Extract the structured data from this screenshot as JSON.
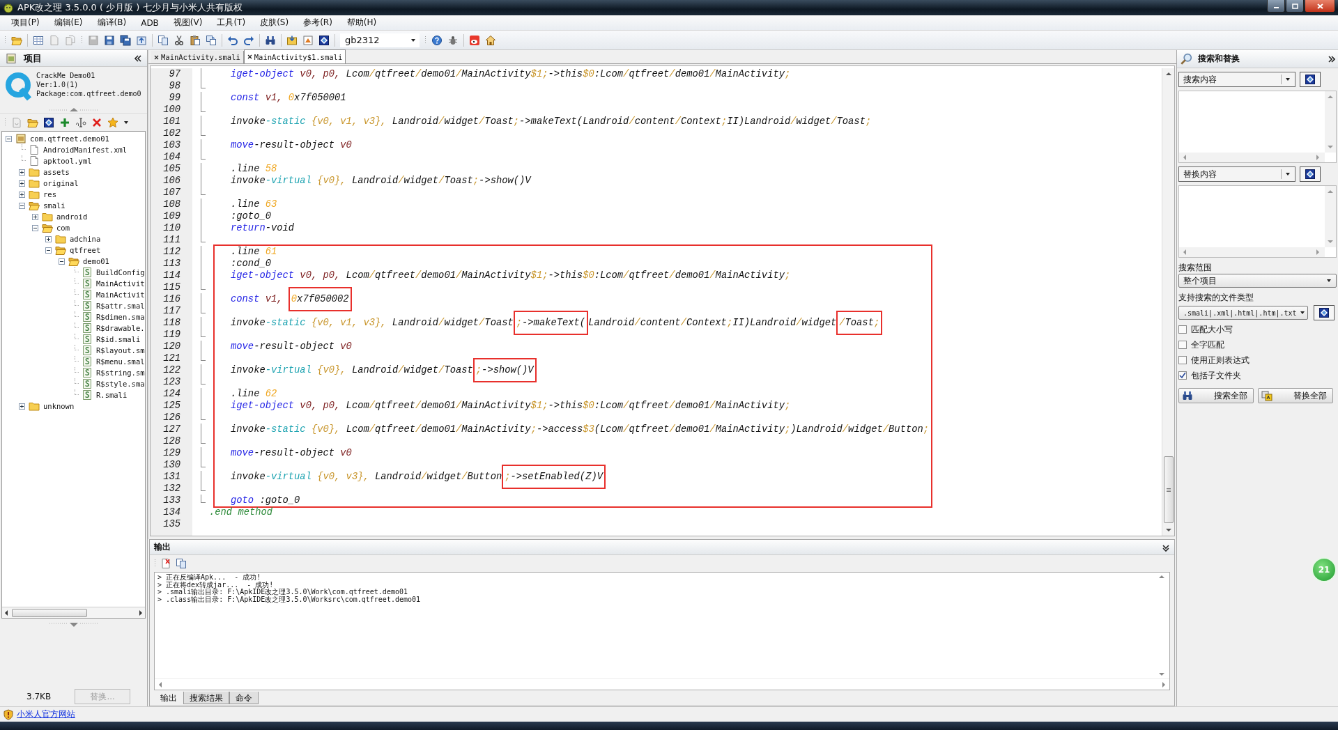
{
  "window": {
    "title": "APK改之理 3.5.0.0 ( 少月版 ) 七少月与小米人共有版权"
  },
  "menu": [
    "项目(P)",
    "编辑(E)",
    "编译(B)",
    "ADB",
    "视图(V)",
    "工具(T)",
    "皮肤(S)",
    "参考(R)",
    "帮助(H)"
  ],
  "toolbar": {
    "encoding": "gb2312"
  },
  "project": {
    "title": "项目",
    "app_name": "CrackMe Demo01",
    "version": "Ver:1.0(1)",
    "package": "Package:com.qtfreet.demo0",
    "tree": [
      {
        "label": "com.qtfreet.demo01",
        "kind": "project",
        "expanded": true,
        "children": [
          {
            "label": "AndroidManifest.xml",
            "kind": "file"
          },
          {
            "label": "apktool.yml",
            "kind": "file"
          },
          {
            "label": "assets",
            "kind": "folder",
            "expanded": false
          },
          {
            "label": "original",
            "kind": "folder",
            "expanded": false
          },
          {
            "label": "res",
            "kind": "folder",
            "expanded": false
          },
          {
            "label": "smali",
            "kind": "folder",
            "expanded": true,
            "children": [
              {
                "label": "android",
                "kind": "folder",
                "expanded": false
              },
              {
                "label": "com",
                "kind": "folder",
                "expanded": true,
                "children": [
                  {
                    "label": "adchina",
                    "kind": "folder",
                    "expanded": false
                  },
                  {
                    "label": "qtfreet",
                    "kind": "folder",
                    "expanded": true,
                    "children": [
                      {
                        "label": "demo01",
                        "kind": "folder",
                        "expanded": true,
                        "children": [
                          {
                            "label": "BuildConfig",
                            "kind": "smali"
                          },
                          {
                            "label": "MainActivit",
                            "kind": "smali"
                          },
                          {
                            "label": "MainActivit",
                            "kind": "smali"
                          },
                          {
                            "label": "R$attr.smal",
                            "kind": "smali"
                          },
                          {
                            "label": "R$dimen.sma",
                            "kind": "smali"
                          },
                          {
                            "label": "R$drawable.",
                            "kind": "smali"
                          },
                          {
                            "label": "R$id.smali",
                            "kind": "smali"
                          },
                          {
                            "label": "R$layout.sm",
                            "kind": "smali"
                          },
                          {
                            "label": "R$menu.smal",
                            "kind": "smali"
                          },
                          {
                            "label": "R$string.sm",
                            "kind": "smali"
                          },
                          {
                            "label": "R$style.sma",
                            "kind": "smali"
                          },
                          {
                            "label": "R.smali",
                            "kind": "smali"
                          }
                        ]
                      }
                    ]
                  }
                ]
              }
            ]
          },
          {
            "label": "unknown",
            "kind": "folder",
            "expanded": false
          }
        ]
      }
    ],
    "size": "3.7KB",
    "replace_button": {
      "label": "替换...",
      "disabled": true
    }
  },
  "editor": {
    "tabs": [
      {
        "label": "MainActivity.smali",
        "selected": false
      },
      {
        "label": "MainActivity$1.smali",
        "selected": true
      }
    ],
    "lines": [
      {
        "number": "97",
        "kind": "body",
        "indented": true,
        "boxed": false,
        "tokens": [
          {
            "kind": "kw",
            "text": "iget-object",
            "marked": false
          },
          {
            "kind": "reg",
            "text": " v0, p0,",
            "marked": false
          },
          {
            "kind": "txt",
            "text": " Lcom/qtfreet/demo01/MainActivity",
            "marked": false
          },
          {
            "kind": "sym",
            "text": "$1",
            "marked": false
          },
          {
            "kind": "txt",
            "text": ";->this",
            "marked": false
          },
          {
            "kind": "sym",
            "text": "$0",
            "marked": false
          },
          {
            "kind": "txt",
            "text": ":Lcom/qtfreet/demo01/MainActivity;",
            "marked": false
          }
        ]
      },
      {
        "number": "98",
        "kind": "end"
      },
      {
        "number": "99",
        "kind": "body",
        "indented": true,
        "boxed": false,
        "tokens": [
          {
            "kind": "kw",
            "text": "const",
            "marked": false
          },
          {
            "kind": "reg",
            "text": " v1, ",
            "marked": false
          },
          {
            "kind": "num",
            "text": "0",
            "marked": false
          },
          {
            "kind": "txt",
            "text": "x7f050001",
            "marked": false
          }
        ]
      },
      {
        "number": "100",
        "kind": "end"
      },
      {
        "number": "101",
        "kind": "body",
        "indented": true,
        "boxed": false,
        "tokens": [
          {
            "kind": "txt",
            "text": "invoke",
            "marked": false
          },
          {
            "kind": "kw2",
            "text": "-static",
            "marked": false
          },
          {
            "kind": "sym",
            "text": " {v0, v1, v3},",
            "marked": false
          },
          {
            "kind": "txt",
            "text": " Landroid/widget/Toast;->makeText(Landroid/content/Context;II)Landroid/widget/Toast;",
            "marked": false
          }
        ]
      },
      {
        "number": "102",
        "kind": "end"
      },
      {
        "number": "103",
        "kind": "body",
        "indented": true,
        "boxed": false,
        "tokens": [
          {
            "kind": "kw",
            "text": "move",
            "marked": false
          },
          {
            "kind": "txt",
            "text": "-result-object",
            "marked": false
          },
          {
            "kind": "reg",
            "text": " v0",
            "marked": false
          }
        ]
      },
      {
        "number": "104",
        "kind": "end"
      },
      {
        "number": "105",
        "kind": "body",
        "indented": true,
        "boxed": false,
        "tokens": [
          {
            "kind": "txt",
            "text": ".line ",
            "marked": false
          },
          {
            "kind": "num",
            "text": "58",
            "marked": false
          }
        ]
      },
      {
        "number": "106",
        "kind": "body",
        "indented": true,
        "boxed": false,
        "tokens": [
          {
            "kind": "txt",
            "text": "invoke",
            "marked": false
          },
          {
            "kind": "kw2",
            "text": "-virtual",
            "marked": false
          },
          {
            "kind": "sym",
            "text": " {v0},",
            "marked": false
          },
          {
            "kind": "txt",
            "text": " Landroid/widget/Toast;->show()V",
            "marked": false
          }
        ]
      },
      {
        "number": "107",
        "kind": "end"
      },
      {
        "number": "108",
        "kind": "body",
        "indented": true,
        "boxed": false,
        "tokens": [
          {
            "kind": "txt",
            "text": ".line ",
            "marked": false
          },
          {
            "kind": "num",
            "text": "63",
            "marked": false
          }
        ]
      },
      {
        "number": "109",
        "kind": "body",
        "indented": true,
        "boxed": false,
        "tokens": [
          {
            "kind": "txt",
            "text": ":goto_0",
            "marked": false
          }
        ]
      },
      {
        "number": "110",
        "kind": "body",
        "indented": true,
        "boxed": false,
        "tokens": [
          {
            "kind": "kw",
            "text": "return",
            "marked": false
          },
          {
            "kind": "txt",
            "text": "-void",
            "marked": false
          }
        ]
      },
      {
        "number": "111",
        "kind": "end"
      },
      {
        "number": "112",
        "kind": "body",
        "indented": true,
        "boxed": true,
        "tokens": [
          {
            "kind": "txt",
            "text": ".line ",
            "marked": false
          },
          {
            "kind": "num",
            "text": "61",
            "marked": false
          }
        ]
      },
      {
        "number": "113",
        "kind": "body",
        "indented": true,
        "boxed": true,
        "tokens": [
          {
            "kind": "txt",
            "text": ":cond_0",
            "marked": false
          }
        ]
      },
      {
        "number": "114",
        "kind": "body",
        "indented": true,
        "boxed": true,
        "tokens": [
          {
            "kind": "kw",
            "text": "iget-object",
            "marked": false
          },
          {
            "kind": "reg",
            "text": " v0, p0,",
            "marked": false
          },
          {
            "kind": "txt",
            "text": " Lcom/qtfreet/demo01/MainActivity",
            "marked": false
          },
          {
            "kind": "sym",
            "text": "$1",
            "marked": false
          },
          {
            "kind": "txt",
            "text": ";->this",
            "marked": false
          },
          {
            "kind": "sym",
            "text": "$0",
            "marked": false
          },
          {
            "kind": "txt",
            "text": ":Lcom/qtfreet/demo01/MainActivity;",
            "marked": false
          }
        ]
      },
      {
        "number": "115",
        "kind": "end"
      },
      {
        "number": "116",
        "kind": "body",
        "indented": true,
        "boxed": true,
        "tokens": [
          {
            "kind": "kw",
            "text": "const",
            "marked": false
          },
          {
            "kind": "reg",
            "text": " v1, ",
            "marked": false
          },
          {
            "kind": "num",
            "text": "0",
            "marked": true
          },
          {
            "kind": "txt",
            "text": "x7f050002",
            "marked": true
          }
        ]
      },
      {
        "number": "117",
        "kind": "end"
      },
      {
        "number": "118",
        "kind": "body",
        "indented": true,
        "boxed": true,
        "tokens": [
          {
            "kind": "txt",
            "text": "invoke",
            "marked": false
          },
          {
            "kind": "kw2",
            "text": "-static",
            "marked": false
          },
          {
            "kind": "sym",
            "text": " {v0, v1, v3},",
            "marked": false
          },
          {
            "kind": "txt",
            "text": " Landroid/widget/Toast",
            "marked": false
          },
          {
            "kind": "txt",
            "text": ";->makeText(",
            "marked": true
          },
          {
            "kind": "txt",
            "text": "Landroid/content/Context;II)Landroid/widget",
            "marked": false
          },
          {
            "kind": "txt",
            "text": "/Toast;",
            "marked": true
          }
        ]
      },
      {
        "number": "119",
        "kind": "end"
      },
      {
        "number": "120",
        "kind": "body",
        "indented": true,
        "boxed": true,
        "tokens": [
          {
            "kind": "kw",
            "text": "move",
            "marked": false
          },
          {
            "kind": "txt",
            "text": "-result-object",
            "marked": false
          },
          {
            "kind": "reg",
            "text": " v0",
            "marked": false
          }
        ]
      },
      {
        "number": "121",
        "kind": "end"
      },
      {
        "number": "122",
        "kind": "body",
        "indented": true,
        "boxed": true,
        "tokens": [
          {
            "kind": "txt",
            "text": "invoke",
            "marked": false
          },
          {
            "kind": "kw2",
            "text": "-virtual",
            "marked": false
          },
          {
            "kind": "sym",
            "text": " {v0},",
            "marked": false
          },
          {
            "kind": "txt",
            "text": " Landroid/widget/Toast",
            "marked": false
          },
          {
            "kind": "txt",
            "text": ";->show()V",
            "marked": true
          }
        ]
      },
      {
        "number": "123",
        "kind": "end"
      },
      {
        "number": "124",
        "kind": "body",
        "indented": true,
        "boxed": true,
        "tokens": [
          {
            "kind": "txt",
            "text": ".line ",
            "marked": false
          },
          {
            "kind": "num",
            "text": "62",
            "marked": false
          }
        ]
      },
      {
        "number": "125",
        "kind": "body",
        "indented": true,
        "boxed": true,
        "tokens": [
          {
            "kind": "kw",
            "text": "iget-object",
            "marked": false
          },
          {
            "kind": "reg",
            "text": " v0, p0,",
            "marked": false
          },
          {
            "kind": "txt",
            "text": " Lcom/qtfreet/demo01/MainActivity",
            "marked": false
          },
          {
            "kind": "sym",
            "text": "$1",
            "marked": false
          },
          {
            "kind": "txt",
            "text": ";->this",
            "marked": false
          },
          {
            "kind": "sym",
            "text": "$0",
            "marked": false
          },
          {
            "kind": "txt",
            "text": ":Lcom/qtfreet/demo01/MainActivity;",
            "marked": false
          }
        ]
      },
      {
        "number": "126",
        "kind": "end"
      },
      {
        "number": "127",
        "kind": "body",
        "indented": true,
        "boxed": true,
        "tokens": [
          {
            "kind": "txt",
            "text": "invoke",
            "marked": false
          },
          {
            "kind": "kw2",
            "text": "-static",
            "marked": false
          },
          {
            "kind": "sym",
            "text": " {v0},",
            "marked": false
          },
          {
            "kind": "txt",
            "text": " Lcom/qtfreet/demo01/MainActivity;->access",
            "marked": false
          },
          {
            "kind": "sym",
            "text": "$3",
            "marked": false
          },
          {
            "kind": "txt",
            "text": "(Lcom/qtfreet/demo01/MainActivity;)Landroid/widget/Button;",
            "marked": false
          }
        ]
      },
      {
        "number": "128",
        "kind": "end"
      },
      {
        "number": "129",
        "kind": "body",
        "indented": true,
        "boxed": true,
        "tokens": [
          {
            "kind": "kw",
            "text": "move",
            "marked": false
          },
          {
            "kind": "txt",
            "text": "-result-object",
            "marked": false
          },
          {
            "kind": "reg",
            "text": " v0",
            "marked": false
          }
        ]
      },
      {
        "number": "130",
        "kind": "end"
      },
      {
        "number": "131",
        "kind": "body",
        "indented": true,
        "boxed": true,
        "tokens": [
          {
            "kind": "txt",
            "text": "invoke",
            "marked": false
          },
          {
            "kind": "kw2",
            "text": "-virtual",
            "marked": false
          },
          {
            "kind": "sym",
            "text": " {v0, v3},",
            "marked": false
          },
          {
            "kind": "txt",
            "text": " Landroid/widget/Button",
            "marked": false
          },
          {
            "kind": "txt",
            "text": ";->setEnabled(Z)V",
            "marked": true
          }
        ]
      },
      {
        "number": "132",
        "kind": "end"
      },
      {
        "number": "133",
        "kind": "end",
        "indented": true,
        "boxed": true,
        "tokens": [
          {
            "kind": "kw",
            "text": "goto",
            "marked": false
          },
          {
            "kind": "txt",
            "text": " :goto_0",
            "marked": false
          }
        ]
      },
      {
        "number": "134",
        "kind": "outside",
        "indented": false,
        "boxed": false,
        "tokens": [
          {
            "kind": "end",
            "text": ".end method",
            "marked": false
          }
        ]
      },
      {
        "number": "135",
        "kind": "outside"
      }
    ]
  },
  "output": {
    "title": "输出",
    "lines": [
      "> 正在反编译Apk...  - 成功!",
      "> 正在将dex转成jar...  - 成功!",
      "> .smali输出目录: F:\\ApkIDE改之理3.5.0\\Work\\com.qtfreet.demo01",
      "> .class输出目录: F:\\ApkIDE改之理3.5.0\\Worksrc\\com.qtfreet.demo01"
    ],
    "tabs": [
      {
        "label": "输出",
        "selected": true
      },
      {
        "label": "搜索结果",
        "selected": false
      },
      {
        "label": "命令",
        "selected": false
      }
    ]
  },
  "search": {
    "title": "搜索和替换",
    "search_field": {
      "value": "搜索内容"
    },
    "replace_field": {
      "value": "替换内容"
    },
    "scope_label": "搜索范围",
    "scope": "整个项目",
    "types_label": "支持搜索的文件类型",
    "types": ".smali|.xml|.html|.htm|.txt",
    "options": [
      {
        "label": "匹配大小写",
        "checked": false
      },
      {
        "label": "全字匹配",
        "checked": false
      },
      {
        "label": "使用正则表达式",
        "checked": false
      },
      {
        "label": "包括子文件夹",
        "checked": true
      }
    ],
    "buttons": [
      {
        "label": "搜索全部",
        "kind": "search"
      },
      {
        "label": "替换全部",
        "kind": "replace"
      }
    ]
  },
  "status_bar": {
    "link": "小米人官方网站"
  },
  "badge": "21"
}
